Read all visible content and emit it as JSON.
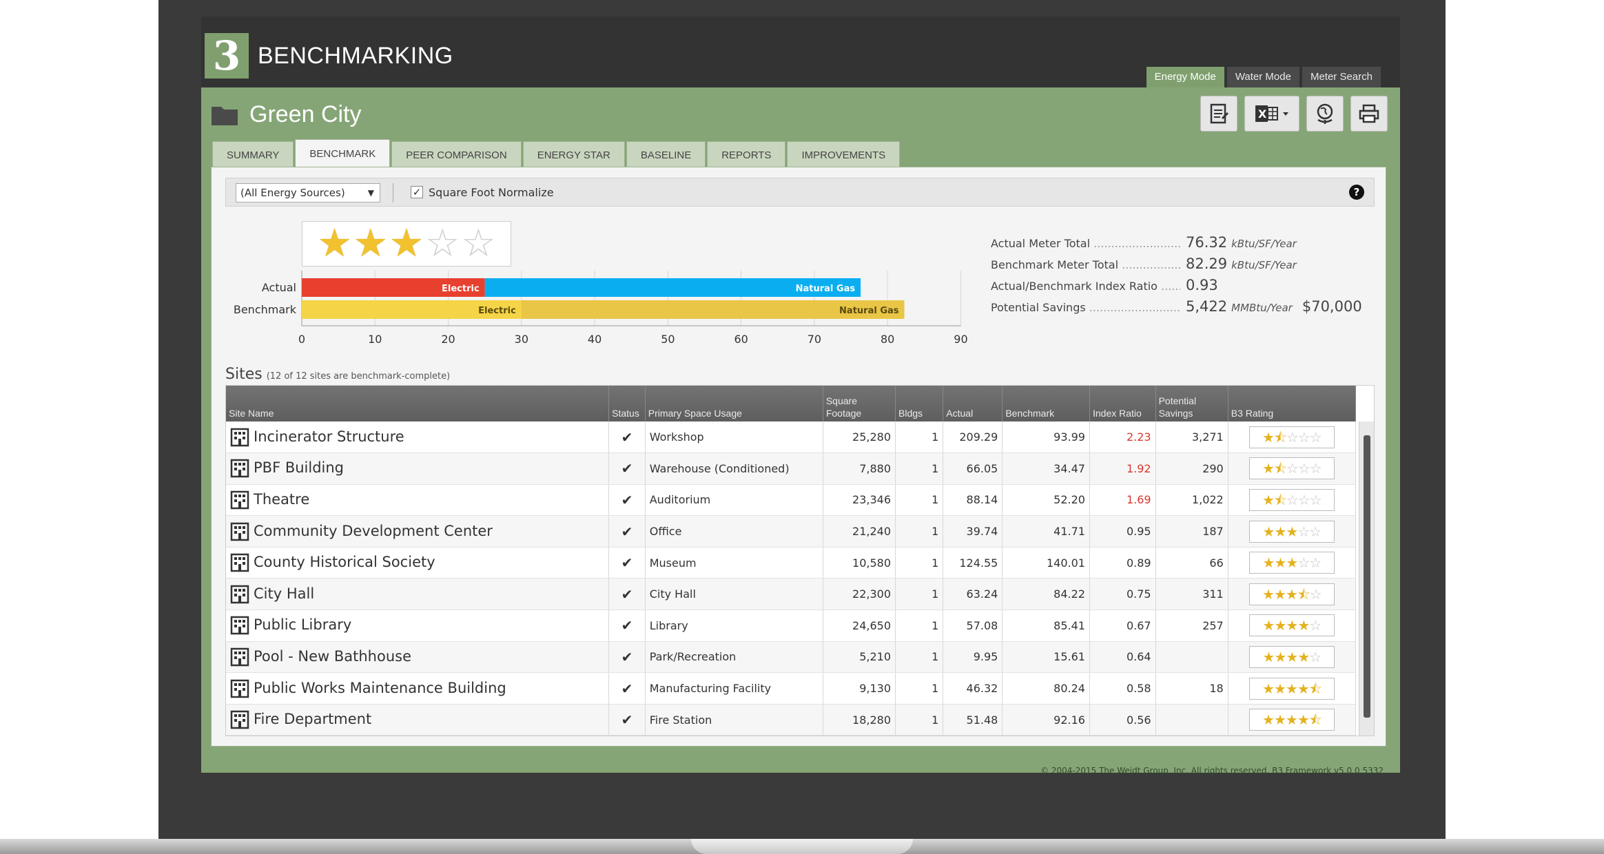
{
  "app": {
    "logo_char": "3",
    "title": "BENCHMARKING"
  },
  "modes": [
    {
      "label": "Energy Mode",
      "active": true
    },
    {
      "label": "Water Mode",
      "active": false
    },
    {
      "label": "Meter Search",
      "active": false
    }
  ],
  "portfolio": {
    "name": "Green City"
  },
  "tools": [
    "report-icon",
    "excel-export-icon",
    "globe-icon",
    "print-icon"
  ],
  "tabs": [
    {
      "label": "SUMMARY",
      "active": false
    },
    {
      "label": "BENCHMARK",
      "active": true
    },
    {
      "label": "PEER COMPARISON",
      "active": false
    },
    {
      "label": "ENERGY STAR",
      "active": false
    },
    {
      "label": "BASELINE",
      "active": false
    },
    {
      "label": "REPORTS",
      "active": false
    },
    {
      "label": "IMPROVEMENTS",
      "active": false
    }
  ],
  "filters": {
    "energy_source": "(All Energy Sources)",
    "normalize_label": "Square Foot Normalize",
    "normalize_checked": true,
    "help": "?"
  },
  "rating": {
    "stars": 3,
    "max": 5
  },
  "chart_data": {
    "type": "bar",
    "orientation": "horizontal",
    "stacked": true,
    "categories": [
      "Actual",
      "Benchmark"
    ],
    "series": [
      {
        "name": "Electric",
        "values": [
          25,
          30
        ],
        "color": "#e8402f",
        "benchmark_color": "#f5d547"
      },
      {
        "name": "Natural Gas",
        "values": [
          51.32,
          52.29
        ],
        "color": "#0aaef0",
        "benchmark_color": "#e9c646"
      }
    ],
    "xlim": [
      0,
      90
    ],
    "xticks": [
      "0",
      "10",
      "20",
      "30",
      "40",
      "50",
      "60",
      "70",
      "80",
      "90"
    ],
    "grid": true
  },
  "summary": [
    {
      "label": "Actual Meter Total",
      "value": "76.32",
      "unit": "kBtu/SF/Year",
      "extra": ""
    },
    {
      "label": "Benchmark Meter Total",
      "value": "82.29",
      "unit": "kBtu/SF/Year",
      "extra": ""
    },
    {
      "label": "Actual/Benchmark Index Ratio",
      "value": "0.93",
      "unit": "",
      "extra": ""
    },
    {
      "label": "Potential Savings",
      "value": "5,422",
      "unit": "MMBtu/Year",
      "extra": "$70,000"
    }
  ],
  "sites": {
    "title": "Sites",
    "subtitle": "(12 of 12 sites are benchmark-complete)",
    "columns": [
      "Site Name",
      "Status",
      "Primary Space Usage",
      "Square Footage",
      "Bldgs",
      "Actual",
      "Benchmark",
      "Index Ratio",
      "Potential Savings",
      "B3 Rating"
    ],
    "rows": [
      {
        "name": "Incinerator Structure",
        "status": "✔",
        "usage": "Workshop",
        "sqft": "25,280",
        "bldgs": "1",
        "actual": "209.29",
        "benchmark": "93.99",
        "ratio": "2.23",
        "ratio_red": true,
        "savings": "3,271",
        "rating": 1.5
      },
      {
        "name": "PBF Building",
        "status": "✔",
        "usage": "Warehouse (Conditioned)",
        "sqft": "7,880",
        "bldgs": "1",
        "actual": "66.05",
        "benchmark": "34.47",
        "ratio": "1.92",
        "ratio_red": true,
        "savings": "290",
        "rating": 1.5
      },
      {
        "name": "Theatre",
        "status": "✔",
        "usage": "Auditorium",
        "sqft": "23,346",
        "bldgs": "1",
        "actual": "88.14",
        "benchmark": "52.20",
        "ratio": "1.69",
        "ratio_red": true,
        "savings": "1,022",
        "rating": 1.5
      },
      {
        "name": "Community Development Center",
        "status": "✔",
        "usage": "Office",
        "sqft": "21,240",
        "bldgs": "1",
        "actual": "39.74",
        "benchmark": "41.71",
        "ratio": "0.95",
        "ratio_red": false,
        "savings": "187",
        "rating": 3
      },
      {
        "name": "County Historical Society",
        "status": "✔",
        "usage": "Museum",
        "sqft": "10,580",
        "bldgs": "1",
        "actual": "124.55",
        "benchmark": "140.01",
        "ratio": "0.89",
        "ratio_red": false,
        "savings": "66",
        "rating": 3
      },
      {
        "name": "City Hall",
        "status": "✔",
        "usage": "City Hall",
        "sqft": "22,300",
        "bldgs": "1",
        "actual": "63.24",
        "benchmark": "84.22",
        "ratio": "0.75",
        "ratio_red": false,
        "savings": "311",
        "rating": 3.5
      },
      {
        "name": "Public Library",
        "status": "✔",
        "usage": "Library",
        "sqft": "24,650",
        "bldgs": "1",
        "actual": "57.08",
        "benchmark": "85.41",
        "ratio": "0.67",
        "ratio_red": false,
        "savings": "257",
        "rating": 4
      },
      {
        "name": "Pool - New Bathhouse",
        "status": "✔",
        "usage": "Park/Recreation",
        "sqft": "5,210",
        "bldgs": "1",
        "actual": "9.95",
        "benchmark": "15.61",
        "ratio": "0.64",
        "ratio_red": false,
        "savings": "",
        "rating": 4
      },
      {
        "name": "Public Works Maintenance Building",
        "status": "✔",
        "usage": "Manufacturing Facility",
        "sqft": "9,130",
        "bldgs": "1",
        "actual": "46.32",
        "benchmark": "80.24",
        "ratio": "0.58",
        "ratio_red": false,
        "savings": "18",
        "rating": 4.5
      },
      {
        "name": "Fire Department",
        "status": "✔",
        "usage": "Fire Station",
        "sqft": "18,280",
        "bldgs": "1",
        "actual": "51.48",
        "benchmark": "92.16",
        "ratio": "0.56",
        "ratio_red": false,
        "savings": "",
        "rating": 4.5
      }
    ]
  },
  "footer": "© 2004-2015 The Weidt Group, Inc. All rights reserved. B3 Framework v5.0.0.5332"
}
